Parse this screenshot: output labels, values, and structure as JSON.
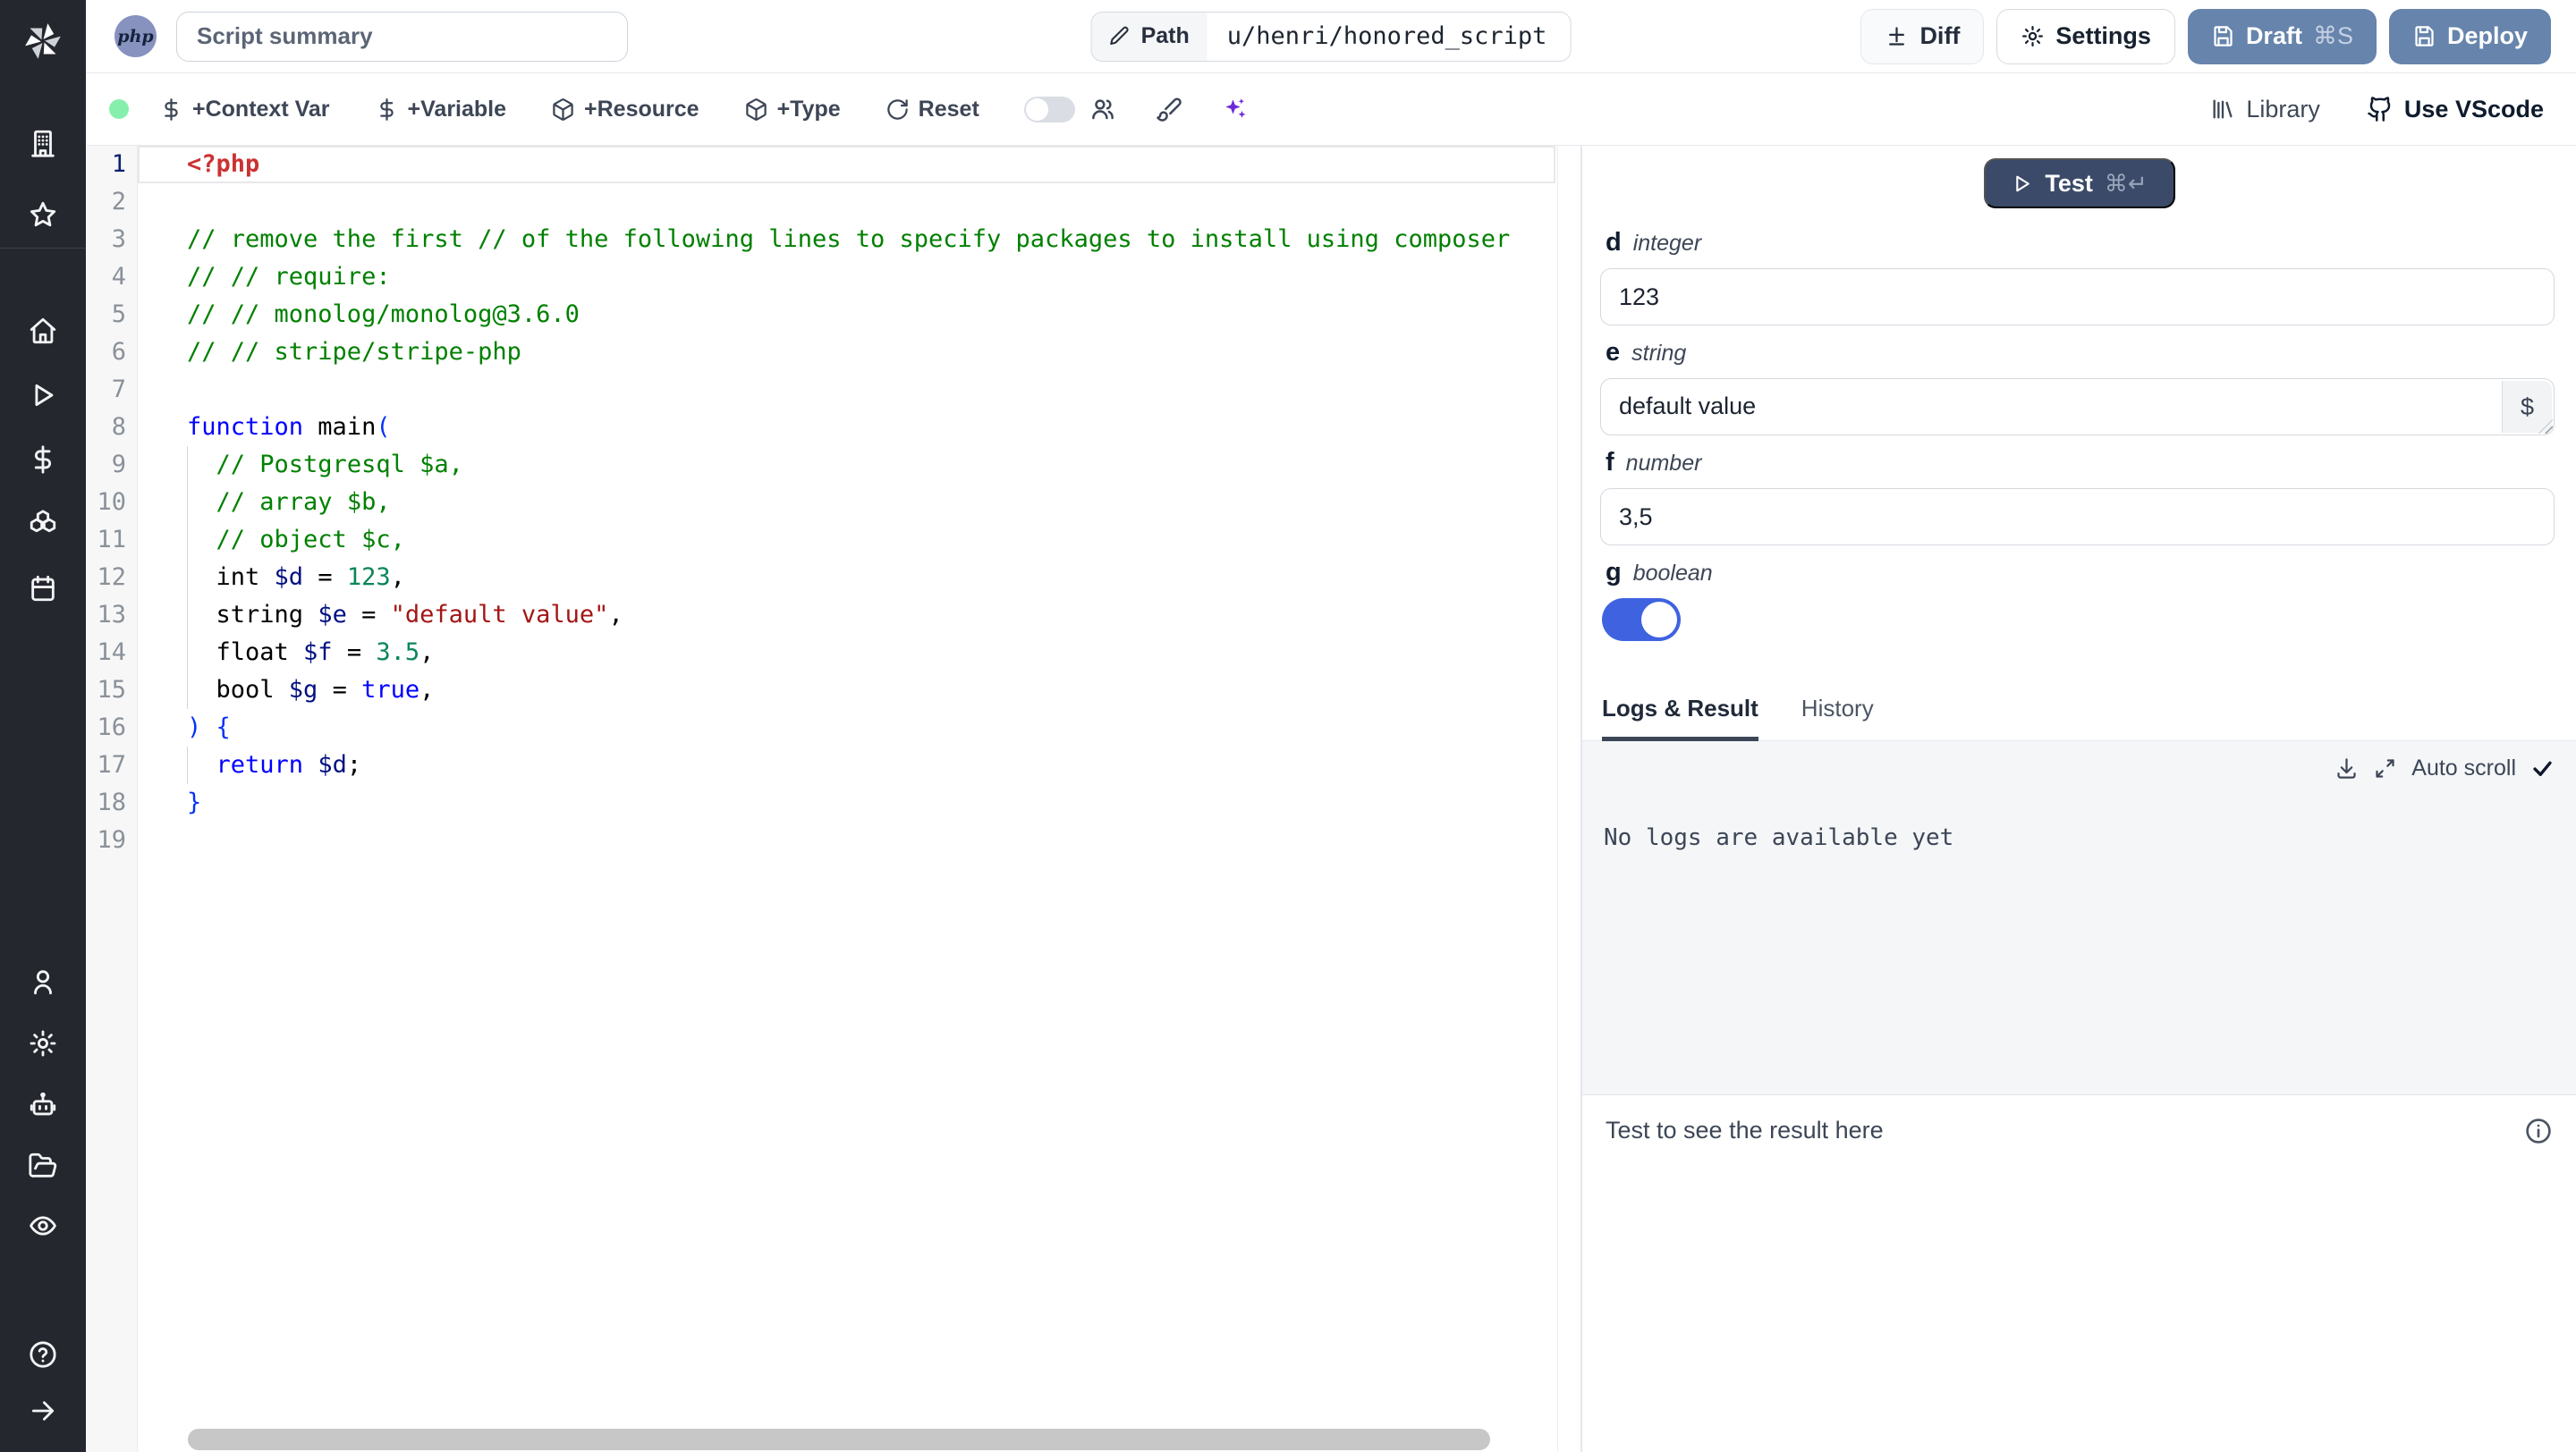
{
  "topbar": {
    "lang_badge": "php",
    "summary_placeholder": "Script summary",
    "path_label": "Path",
    "path_value": "u/henri/honored_script",
    "diff_label": "Diff",
    "settings_label": "Settings",
    "draft_label": "Draft",
    "draft_shortcut": "⌘S",
    "deploy_label": "Deploy"
  },
  "toolbar": {
    "context_var": "+Context Var",
    "variable": "+Variable",
    "resource": "+Resource",
    "type": "+Type",
    "reset": "Reset",
    "library": "Library",
    "vscode": "Use VScode"
  },
  "editor": {
    "language": "php",
    "lines": [
      {
        "n": 1,
        "current": true,
        "tokens": [
          [
            "meta",
            "<?php"
          ]
        ]
      },
      {
        "n": 2,
        "tokens": []
      },
      {
        "n": 3,
        "tokens": [
          [
            "com",
            "// remove the first // of the following lines to specify packages to install using composer"
          ]
        ]
      },
      {
        "n": 4,
        "tokens": [
          [
            "com",
            "// // require:"
          ]
        ]
      },
      {
        "n": 5,
        "tokens": [
          [
            "com",
            "// // monolog/monolog@3.6.0"
          ]
        ]
      },
      {
        "n": 6,
        "tokens": [
          [
            "com",
            "// // stripe/stripe-php"
          ]
        ]
      },
      {
        "n": 7,
        "tokens": []
      },
      {
        "n": 8,
        "tokens": [
          [
            "kw",
            "function"
          ],
          [
            "pl",
            " main"
          ],
          [
            "br",
            "("
          ]
        ]
      },
      {
        "n": 9,
        "guide": true,
        "tokens": [
          [
            "pl",
            "  "
          ],
          [
            "com",
            "// Postgresql $a,"
          ]
        ]
      },
      {
        "n": 10,
        "guide": true,
        "tokens": [
          [
            "pl",
            "  "
          ],
          [
            "com",
            "// array $b,"
          ]
        ]
      },
      {
        "n": 11,
        "guide": true,
        "tokens": [
          [
            "pl",
            "  "
          ],
          [
            "com",
            "// object $c,"
          ]
        ]
      },
      {
        "n": 12,
        "guide": true,
        "tokens": [
          [
            "pl",
            "  int "
          ],
          [
            "var",
            "$d"
          ],
          [
            "pl",
            " = "
          ],
          [
            "num",
            "123"
          ],
          [
            "pl",
            ","
          ]
        ]
      },
      {
        "n": 13,
        "guide": true,
        "tokens": [
          [
            "pl",
            "  string "
          ],
          [
            "var",
            "$e"
          ],
          [
            "pl",
            " = "
          ],
          [
            "str",
            "\"default value\""
          ],
          [
            "pl",
            ","
          ]
        ]
      },
      {
        "n": 14,
        "guide": true,
        "tokens": [
          [
            "pl",
            "  float "
          ],
          [
            "var",
            "$f"
          ],
          [
            "pl",
            " = "
          ],
          [
            "num",
            "3.5"
          ],
          [
            "pl",
            ","
          ]
        ]
      },
      {
        "n": 15,
        "guide": true,
        "tokens": [
          [
            "pl",
            "  bool "
          ],
          [
            "var",
            "$g"
          ],
          [
            "pl",
            " = "
          ],
          [
            "kw",
            "true"
          ],
          [
            "pl",
            ","
          ]
        ]
      },
      {
        "n": 16,
        "tokens": [
          [
            "br",
            ") {"
          ]
        ]
      },
      {
        "n": 17,
        "guide": true,
        "tokens": [
          [
            "pl",
            "  "
          ],
          [
            "kw",
            "return"
          ],
          [
            "pl",
            " "
          ],
          [
            "var",
            "$d"
          ],
          [
            "pl",
            ";"
          ]
        ]
      },
      {
        "n": 18,
        "tokens": [
          [
            "br",
            "}"
          ]
        ]
      },
      {
        "n": 19,
        "tokens": []
      }
    ]
  },
  "runform": {
    "test_label": "Test",
    "test_shortcut": "⌘↵",
    "fields": [
      {
        "name": "d",
        "type": "integer",
        "value": "123"
      },
      {
        "name": "e",
        "type": "string",
        "value": "default value",
        "variable_picker": "$"
      },
      {
        "name": "f",
        "type": "number",
        "value": "3,5"
      },
      {
        "name": "g",
        "type": "boolean",
        "value": true
      }
    ]
  },
  "logs": {
    "tab_logs": "Logs & Result",
    "tab_history": "History",
    "auto_scroll_label": "Auto scroll",
    "empty_message": "No logs are available yet"
  },
  "result": {
    "placeholder": "Test to see the result here"
  },
  "colors": {
    "accent_button": "#6684ac",
    "test_button": "#3b4a68",
    "toggle_on": "#3f63e0",
    "status_dot": "#86efac",
    "ai_icon": "#6d28d9",
    "sidebar_bg": "#24272e"
  }
}
